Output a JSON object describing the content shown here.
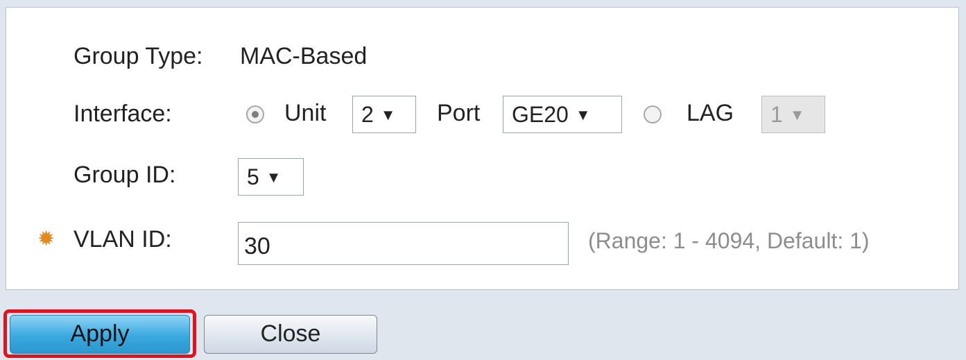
{
  "form": {
    "group_type_label": "Group Type:",
    "group_type_value": "MAC-Based",
    "interface_label": "Interface:",
    "unit_label": "Unit",
    "unit_value": "2",
    "port_label": "Port",
    "port_value": "GE20",
    "lag_label": "LAG",
    "lag_value": "1",
    "group_id_label": "Group ID:",
    "group_id_value": "5",
    "vlan_id_label": "VLAN ID:",
    "vlan_id_value": "30",
    "vlan_hint": "(Range: 1 - 4094, Default: 1)",
    "interface_selected": "unit"
  },
  "buttons": {
    "apply_label": "Apply",
    "close_label": "Close"
  },
  "icons": {
    "required": "required-asterisk-icon",
    "dropdown": "chevron-down-icon"
  },
  "colors": {
    "highlight": "#e1131c",
    "apply_button": "#3aa9df",
    "required_icon": "#e58a1f"
  }
}
